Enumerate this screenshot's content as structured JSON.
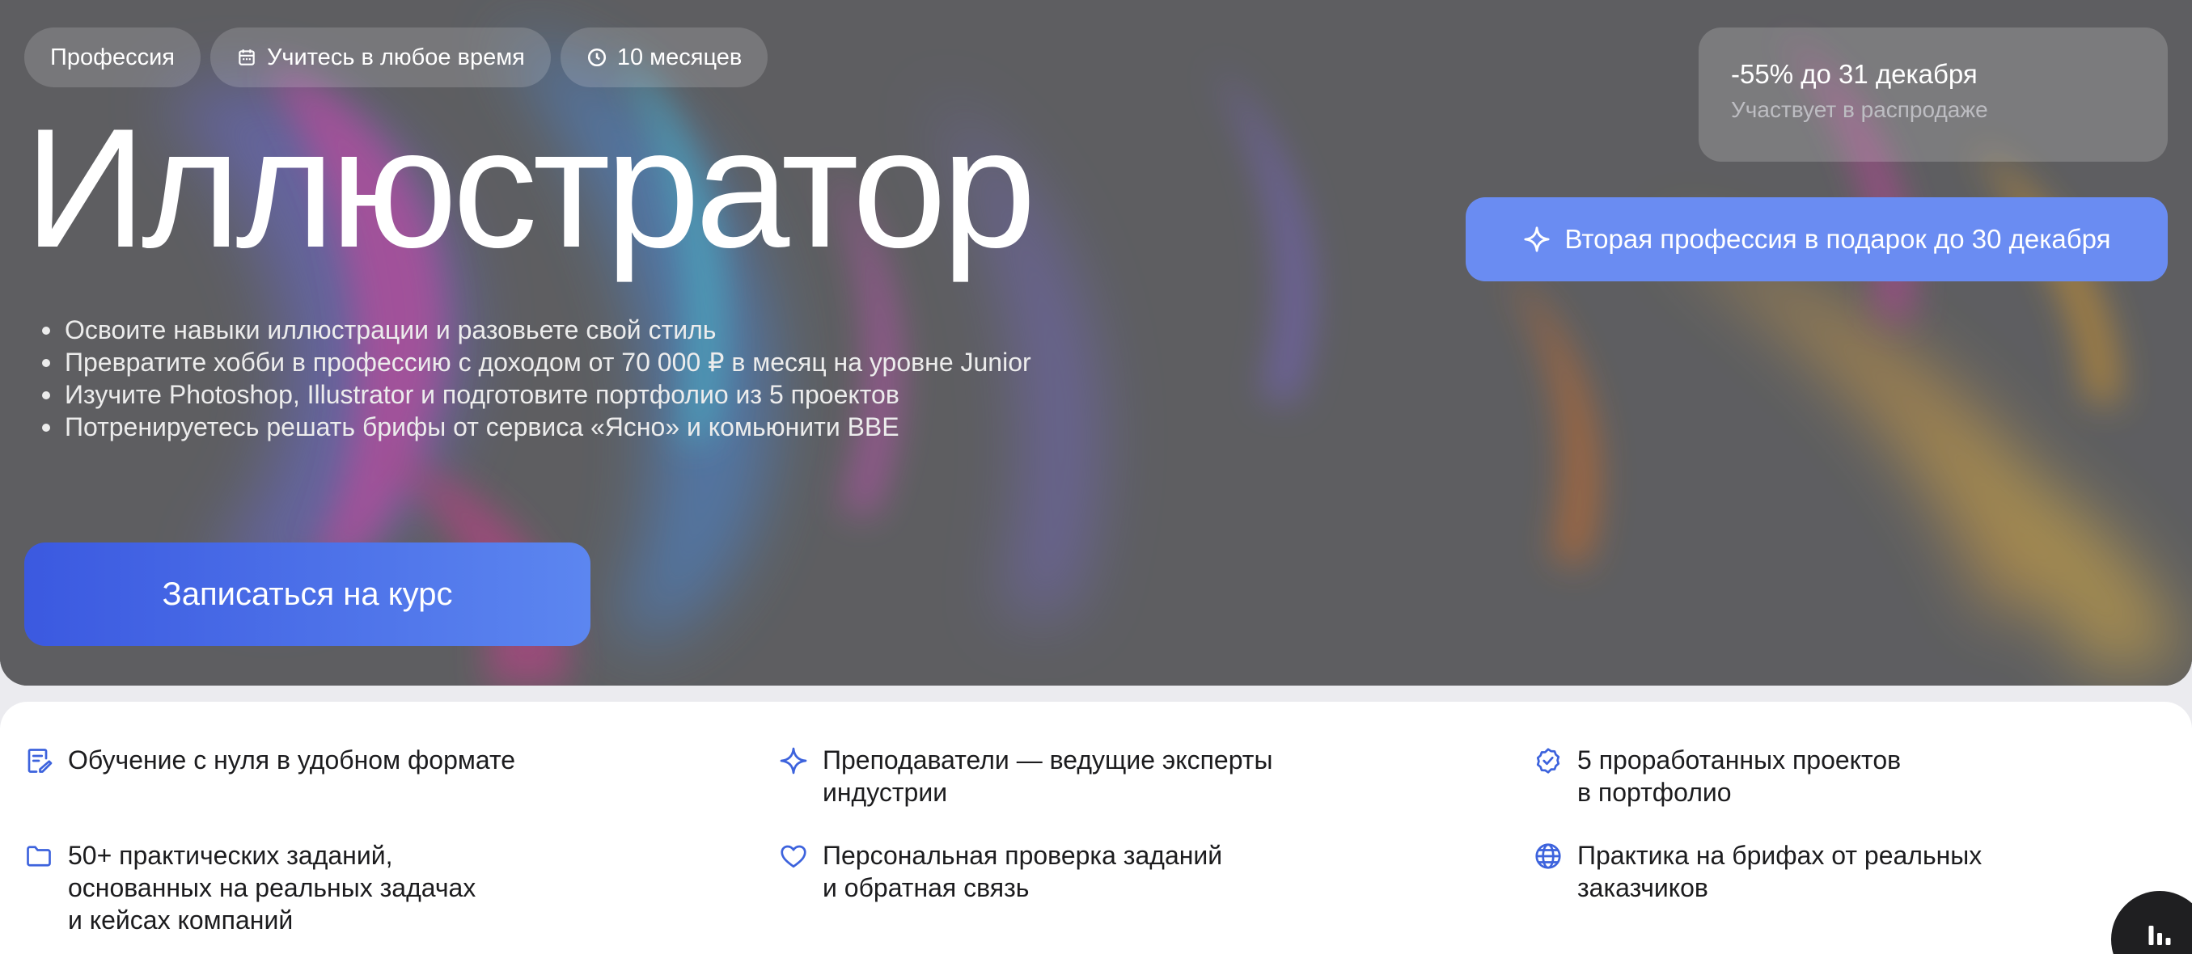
{
  "hero": {
    "chips": [
      {
        "label": "Профессия",
        "icon": ""
      },
      {
        "label": "Учитесь в любое время",
        "icon": "calendar-icon"
      },
      {
        "label": "10 месяцев",
        "icon": "clock-icon"
      }
    ],
    "title": "Иллюстратор",
    "bullets": [
      "Освоите навыки иллюстрации и разовьете свой стиль",
      "Превратите хобби в профессию с доходом от 70 000 ₽ в месяц на уровне Junior",
      "Изучите Photoshop, Illustrator и подготовите портфолио из 5 проектов",
      "Потренируетесь решать брифы от сервиса «Ясно» и комьюнити BBE"
    ],
    "cta_label": "Записаться на курс",
    "promo": {
      "title": "-55% до 31 декабря",
      "subtitle": "Участвует в распродаже"
    },
    "gift": {
      "label": "Вторая профессия в подарок до 30 декабря",
      "icon": "sparkle-icon"
    }
  },
  "features": [
    {
      "icon": "edit-note-icon",
      "text": "Обучение с нуля в удобном формате"
    },
    {
      "icon": "sparkle-icon",
      "text": "Преподаватели — ведущие эксперты\nиндустрии"
    },
    {
      "icon": "badge-check-icon",
      "text": "5 проработанных проектов\nв портфолио"
    },
    {
      "icon": "folder-icon",
      "text": "50+ практических заданий,\nоснованных на реальных задачах\nи кейсах компаний"
    },
    {
      "icon": "heart-icon",
      "text": "Персональная проверка заданий\nи обратная связь"
    },
    {
      "icon": "globe-icon",
      "text": "Практика на брифах от реальных\nзаказчиков"
    }
  ],
  "fab": {
    "icon": "chart-bars-icon"
  },
  "colors": {
    "accent": "#4a6ee8",
    "hero_bg": "#5f6062",
    "icon_blue": "#3d63dd"
  }
}
